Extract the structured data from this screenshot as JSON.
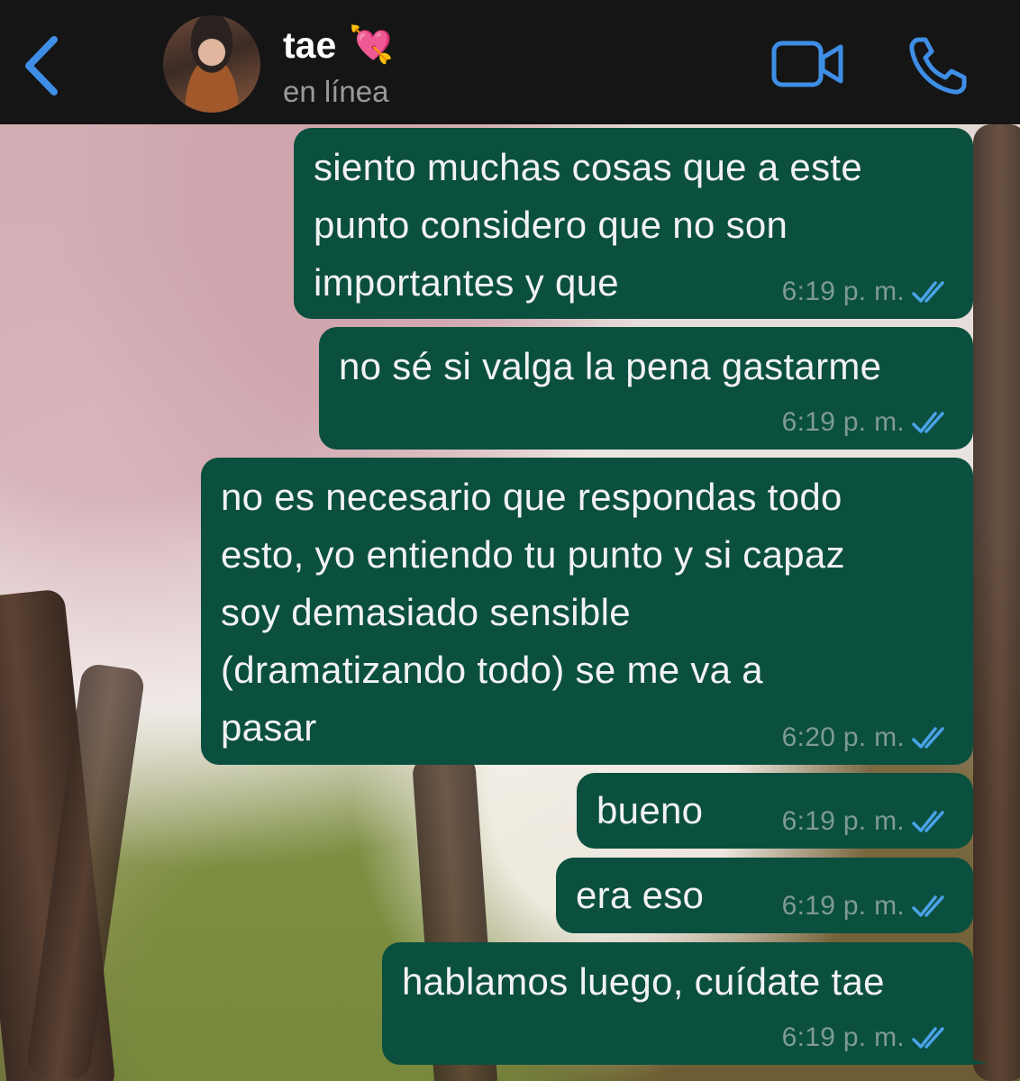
{
  "header": {
    "contact_name": "tae",
    "name_emoji": "💘",
    "status": "en línea",
    "icons": {
      "back": "chevron-left-icon",
      "video": "video-camera-icon",
      "call": "phone-icon"
    },
    "accent_color": "#3f8ee6"
  },
  "messages": [
    {
      "lines": [
        "siento muchas cosas que a este",
        "punto considero que no son",
        "importantes y que"
      ],
      "time": "6:19 p. m."
    },
    {
      "lines": [
        "no sé si valga la pena gastarme"
      ],
      "time": "6:19 p. m."
    },
    {
      "lines": [
        "no es necesario que respondas todo",
        "esto, yo entiendo tu punto y si capaz",
        "soy demasiado sensible",
        "(dramatizando todo) se me va a",
        "pasar"
      ],
      "time": "6:20 p. m."
    },
    {
      "lines": [
        "bueno"
      ],
      "time": "6:19 p. m."
    },
    {
      "lines": [
        "era eso"
      ],
      "time": "6:19 p. m."
    },
    {
      "lines": [
        "hablamos luego, cuídate tae"
      ],
      "time": "6:19 p. m."
    }
  ],
  "colors": {
    "header_bg": "#151515",
    "bubble_bg": "#0b4f3f",
    "read_tick": "#4aa3e8"
  }
}
